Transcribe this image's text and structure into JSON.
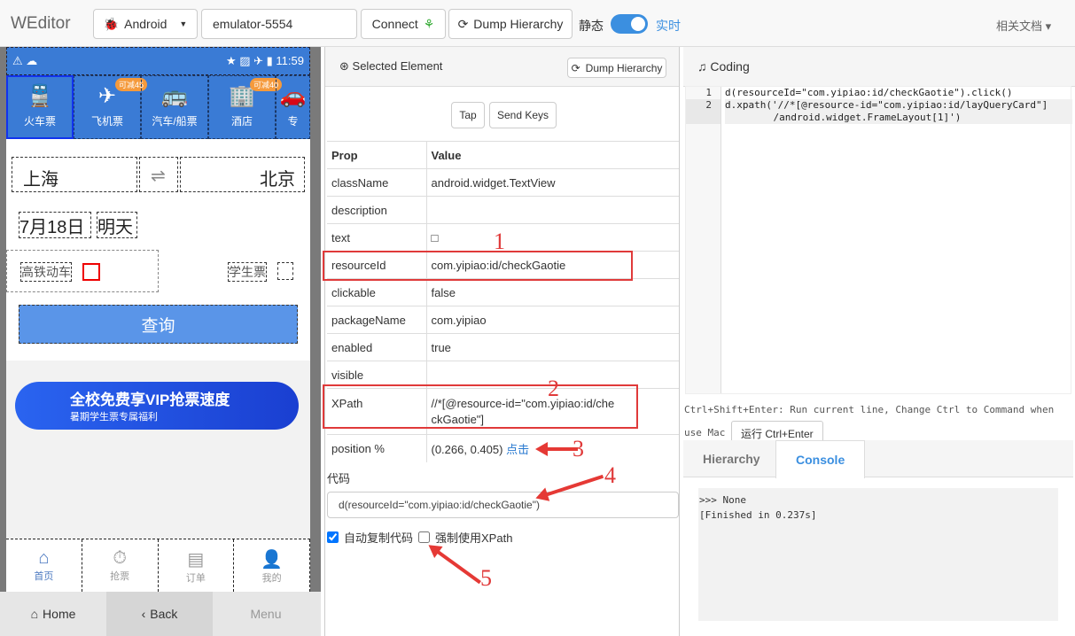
{
  "navbar": {
    "brand": "WEditor",
    "platform": "Android",
    "device": "emulator-5554",
    "connect": "Connect",
    "dump": "Dump Hierarchy",
    "static_label": "静态",
    "realtime_label": "实时",
    "docs": "相关文档"
  },
  "phone": {
    "status_time": "11:59",
    "top_nav": [
      {
        "label": "火车票",
        "icon": "train-icon"
      },
      {
        "label": "飞机票",
        "icon": "plane-icon",
        "badge": "可减45"
      },
      {
        "label": "汽车/船票",
        "icon": "bus-icon"
      },
      {
        "label": "酒店",
        "icon": "hotel-icon",
        "badge": "可减40"
      },
      {
        "label": "专",
        "icon": "car-icon"
      }
    ],
    "from": "上海",
    "to": "北京",
    "swap": "⇌",
    "date": "7月18日",
    "day": "明天",
    "train_type": "高铁动车",
    "student": "学生票",
    "query": "查询",
    "banner_title": "全校免费享VIP抢票速度",
    "banner_sub": "暑期学生票专属福利",
    "tabs": [
      {
        "label": "首页",
        "icon": "home-icon",
        "active": true
      },
      {
        "label": "抢票",
        "icon": "timer-icon"
      },
      {
        "label": "订单",
        "icon": "order-icon"
      },
      {
        "label": "我的",
        "icon": "user-icon"
      }
    ],
    "buttons": {
      "home": "Home",
      "back": "Back",
      "menu": "Menu"
    }
  },
  "inspector": {
    "title": "Selected Element",
    "dump": "Dump Hierarchy",
    "tap": "Tap",
    "send_keys": "Send Keys",
    "headers": [
      "Prop",
      "Value"
    ],
    "rows": [
      [
        "className",
        "android.widget.TextView"
      ],
      [
        "description",
        ""
      ],
      [
        "text",
        "□"
      ],
      [
        "resourceId",
        "com.yipiao:id/checkGaotie"
      ],
      [
        "clickable",
        "false"
      ],
      [
        "packageName",
        "com.yipiao"
      ],
      [
        "enabled",
        "true"
      ],
      [
        "visible",
        ""
      ],
      [
        "XPath",
        "//*[@resource-id=\"com.yipiao:id/checkGaotie\"]"
      ],
      [
        "position %",
        "(0.266, 0.405)"
      ]
    ],
    "click_link": "点击",
    "code_label": "代码",
    "code_value": "d(resourceId=\"com.yipiao:id/checkGaotie\")",
    "auto_copy": "自动复制代码",
    "auto_copy_checked": true,
    "force_xpath": "强制使用XPath",
    "force_xpath_checked": false
  },
  "coding": {
    "title": "Coding",
    "lines": [
      "1",
      "2"
    ],
    "code1": "d(resourceId=\"com.yipiao:id/checkGaotie\").click()",
    "code2a": "d.xpath('//*[@resource-id=\"com.yipiao:id/layQueryCard\"]",
    "code2b": "    /android.widget.FrameLayout[1]')",
    "hint": "Ctrl+Shift+Enter: Run current line, Change Ctrl to Command when use Mac",
    "run": "运行 Ctrl+Enter",
    "tabs": [
      "Hierarchy",
      "Console"
    ],
    "console": [
      ">>> None",
      "[Finished in 0.237s]"
    ]
  },
  "annotations": [
    "1",
    "2",
    "3",
    "4",
    "5"
  ],
  "colors": {
    "accent": "#3b8fe0",
    "phone_blue": "#3a7bd5",
    "annotation": "#e03a3a"
  }
}
